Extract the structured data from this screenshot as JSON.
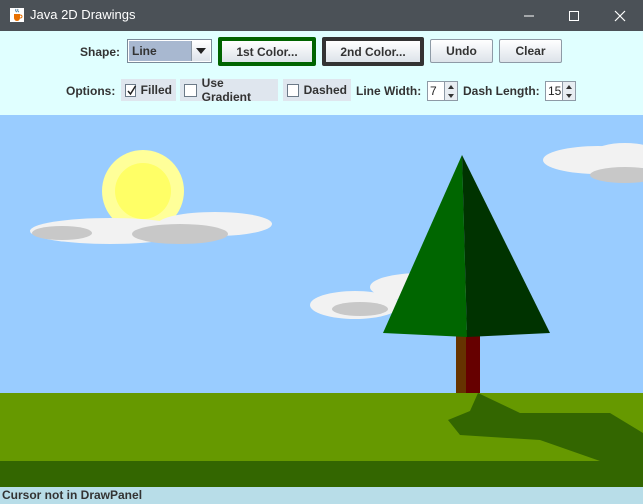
{
  "window": {
    "title": "Java 2D Drawings",
    "app_icon": "java-cup-icon",
    "minimize_icon": "minimize-icon",
    "maximize_icon": "maximize-icon",
    "close_icon": "close-icon"
  },
  "toolbar": {
    "shape_label": "Shape:",
    "shape_value": "Line",
    "first_color_label": "1st Color...",
    "first_color": "#006400",
    "second_color_label": "2nd Color...",
    "second_color": "#333333",
    "undo_label": "Undo",
    "clear_label": "Clear"
  },
  "options": {
    "label": "Options:",
    "filled_label": "Filled",
    "filled_checked": true,
    "gradient_label": "Use Gradient",
    "gradient_checked": false,
    "dashed_label": "Dashed",
    "dashed_checked": false,
    "line_width_label": "Line Width:",
    "line_width_value": "7",
    "dash_length_label": "Dash Length:",
    "dash_length_value": "15"
  },
  "canvas": {
    "sky_color": "#99ccff",
    "grass_color": "#669900",
    "dark_grass_color": "#336600",
    "sun_color": "#ffff99",
    "tree_light": "#006600",
    "tree_dark": "#003300",
    "trunk_color": "#660000"
  },
  "status": {
    "text": "Cursor not in DrawPanel"
  }
}
